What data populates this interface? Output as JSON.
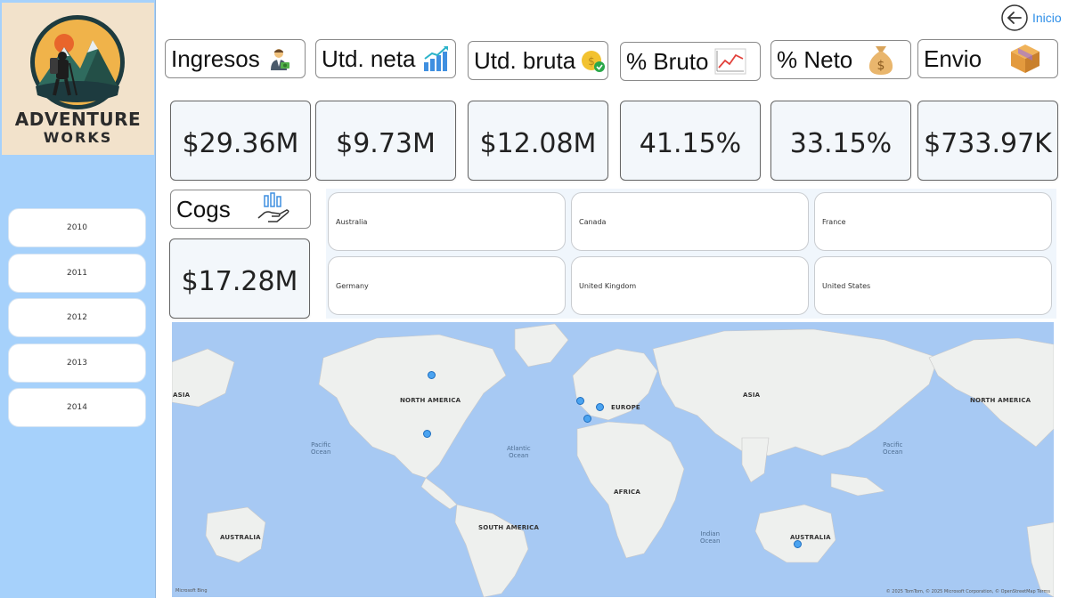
{
  "sidebar": {
    "logo": {
      "title": "ADVENTURE",
      "subtitle": "WORKS"
    },
    "years": [
      "2010",
      "2011",
      "2012",
      "2013",
      "2014"
    ]
  },
  "nav": {
    "back_label": "Inicio"
  },
  "kpis": [
    {
      "label": "Ingresos",
      "icon": "businessman-money-icon",
      "value": "$29.36M"
    },
    {
      "label": "Utd. neta",
      "icon": "bar-growth-icon",
      "value": "$9.73M"
    },
    {
      "label": "Utd. bruta",
      "icon": "coin-check-icon",
      "value": "$12.08M"
    },
    {
      "label": "% Bruto",
      "icon": "line-chart-icon",
      "value": "41.15%"
    },
    {
      "label": "% Neto",
      "icon": "money-bag-icon",
      "value": "33.15%"
    },
    {
      "label": "Envio",
      "icon": "package-box-icon",
      "value": "$733.97K"
    },
    {
      "label": "Cogs",
      "icon": "hand-chart-icon",
      "value": "$17.28M"
    }
  ],
  "countries": [
    "Australia",
    "Canada",
    "France",
    "Germany",
    "United Kingdom",
    "United States"
  ],
  "map": {
    "regions": [
      "ASIA",
      "NORTH AMERICA",
      "EUROPE",
      "ASIA",
      "NORTH AMERICA",
      "AFRICA",
      "SOUTH AMERICA",
      "AUSTRALIA",
      "AUSTRALIA"
    ],
    "oceans": [
      "Pacific\nOcean",
      "Atlantic\nOcean",
      "Pacific\nOcean",
      "Indian\nOcean"
    ],
    "attribution": "© 2025 TomTom, © 2025 Microsoft Corporation, © OpenStreetMap  Terms",
    "provider": "Microsoft Bing"
  },
  "colors": {
    "sidebar": "#a6d1fb",
    "card": "#f3f7fb",
    "map_water": "#a7c9f3",
    "dot": "#4aa3f0",
    "link": "#2f8fe8"
  }
}
